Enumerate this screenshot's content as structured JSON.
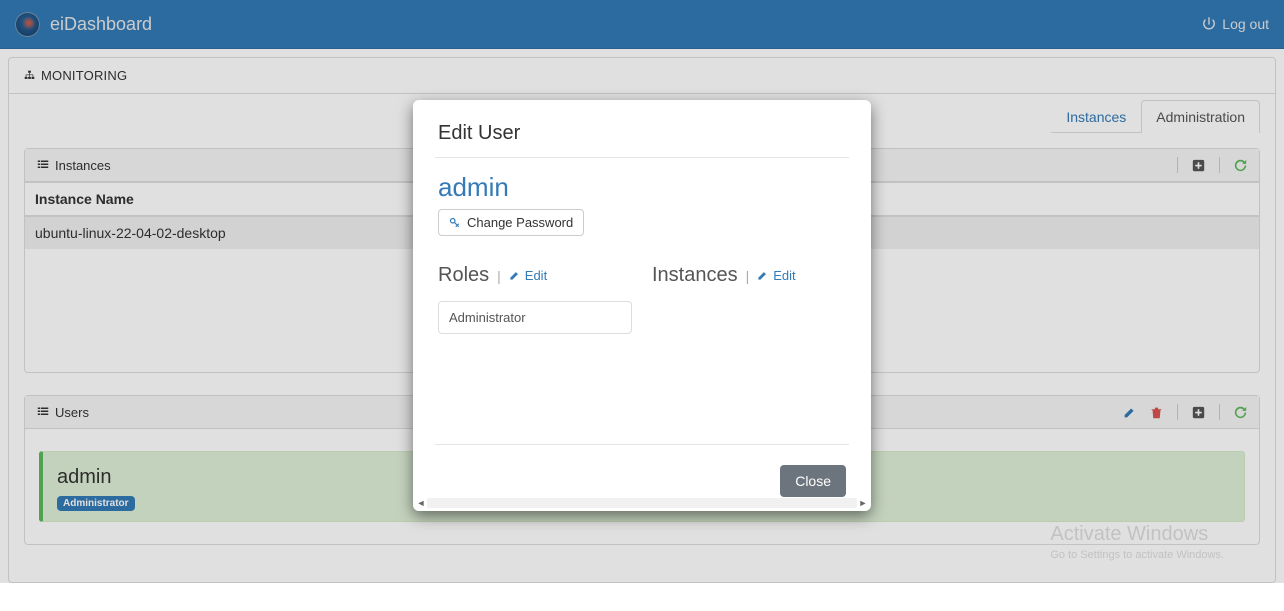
{
  "navbar": {
    "brand": "eiDashboard",
    "logout": "Log out"
  },
  "monitoring": {
    "heading": "MONITORING"
  },
  "tabs": {
    "instances": "Instances",
    "administration": "Administration",
    "active": "administration"
  },
  "instances_panel": {
    "title": "Instances",
    "column_header": "Instance Name",
    "rows": [
      "ubuntu-linux-22-04-02-desktop"
    ]
  },
  "users_panel": {
    "title": "Users",
    "user": {
      "name": "admin",
      "role_badge": "Administrator"
    }
  },
  "modal": {
    "title": "Edit User",
    "username": "admin",
    "change_password": "Change Password",
    "roles_heading": "Roles",
    "instances_heading": "Instances",
    "edit_label": "Edit",
    "roles": [
      "Administrator"
    ],
    "close": "Close"
  },
  "watermark": {
    "line1": "Activate Windows",
    "line2": "Go to Settings to activate Windows."
  }
}
